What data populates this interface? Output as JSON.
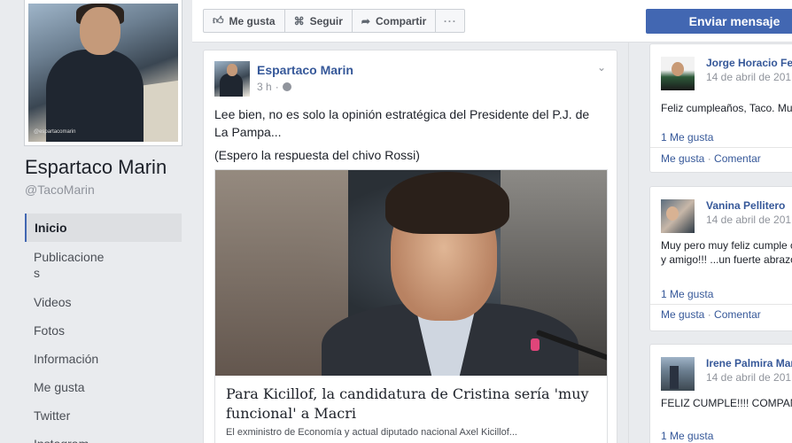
{
  "profile": {
    "name": "Espartaco Marin",
    "handle": "@TacoMarin",
    "photo_watermark": "@espartacomarin"
  },
  "nav": {
    "items": [
      {
        "label": "Inicio",
        "active": true
      },
      {
        "label": "Publicacione\ns",
        "active": false
      },
      {
        "label": "Videos",
        "active": false
      },
      {
        "label": "Fotos",
        "active": false
      },
      {
        "label": "Información",
        "active": false
      },
      {
        "label": "Me gusta",
        "active": false
      },
      {
        "label": "Twitter",
        "active": false
      },
      {
        "label": "Instagram",
        "active": false
      }
    ]
  },
  "actions": {
    "like_label": "Me gusta",
    "like_icon": "thumbs-up-icon",
    "follow_label": "Seguir",
    "follow_icon": "rss-icon",
    "share_label": "Compartir",
    "share_icon": "share-arrow-icon",
    "more_label": "···",
    "send_message_label": "Enviar mensaje"
  },
  "post": {
    "author": "Espartaco Marin",
    "time": "3 h",
    "time_separator": "·",
    "privacy_icon": "globe-icon",
    "menu_icon": "chevron-down-icon",
    "text_line1": "Lee bien, no es solo la opinión estratégica del Presidente del P.J. de La Pampa...",
    "text_line2": "(Espero la respuesta del chivo Rossi)",
    "link": {
      "title": "Para Kicillof, la candidatura de Cristina sería 'muy funcional' a Macri",
      "description": "El exministro de Economía y actual diputado nacional Axel Kicillof..."
    }
  },
  "wall_posts": [
    {
      "name": "Jorge Horacio Fe",
      "date": "14 de abril de 201",
      "text": [
        "Feliz cumpleaños, Taco. Mu"
      ],
      "likes": "1 Me gusta",
      "like_action": "Me gusta",
      "comment_action": "Comentar"
    },
    {
      "name": "Vanina Pellitero",
      "date": "14 de abril de 201",
      "text": [
        "Muy pero muy feliz cumple c",
        "y amigo!!! ...un fuerte abrazo"
      ],
      "likes": "1 Me gusta",
      "like_action": "Me gusta",
      "comment_action": "Comentar"
    },
    {
      "name": "Irene Palmira Mar",
      "date": "14 de abril de 201",
      "text": [
        "FELIZ CUMPLE!!!! COMPAÑ"
      ],
      "likes": "1 Me gusta",
      "like_action": "Me gusta",
      "comment_action": "Comentar"
    }
  ],
  "colors": {
    "brand_blue": "#4267b2",
    "link_blue": "#365899",
    "page_bg": "#e9ebee"
  }
}
